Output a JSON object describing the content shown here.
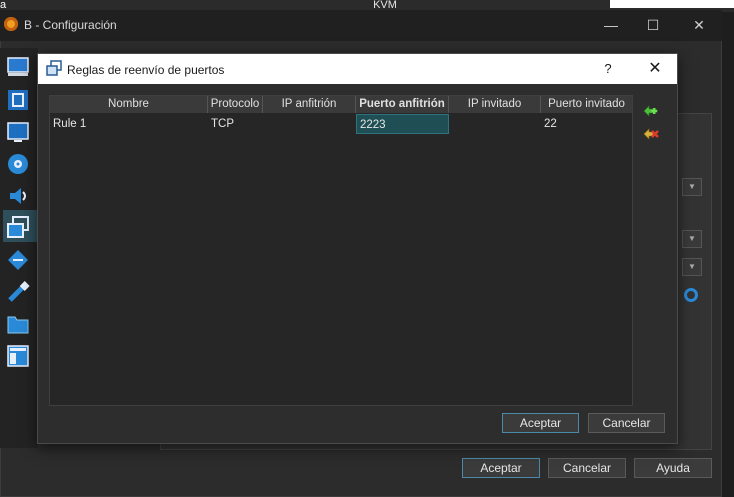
{
  "background": {
    "top_left_text": "a",
    "top_tab_text": "KVM"
  },
  "window": {
    "title": "B - Configuración",
    "minimize_glyph": "—",
    "maximize_glyph": "☐",
    "close_glyph": "✕"
  },
  "sidebar": {
    "items": [
      {
        "name": "general-icon"
      },
      {
        "name": "system-icon"
      },
      {
        "name": "display-icon"
      },
      {
        "name": "storage-icon"
      },
      {
        "name": "audio-icon"
      },
      {
        "name": "network-icon",
        "active": true
      },
      {
        "name": "serial-ports-icon"
      },
      {
        "name": "usb-icon"
      },
      {
        "name": "shared-folders-icon"
      },
      {
        "name": "user-interface-icon"
      }
    ]
  },
  "dialog": {
    "title": "Reglas de reenvío de puertos",
    "help_glyph": "?",
    "close_glyph": "✕",
    "columns": [
      "Nombre",
      "Protocolo",
      "IP anfitrión",
      "Puerto anfitrión",
      "IP invitado",
      "Puerto invitado"
    ],
    "rows": [
      {
        "name": "Rule 1",
        "protocol": "TCP",
        "host_ip": "",
        "host_port": "2223",
        "guest_ip": "",
        "guest_port": "22"
      }
    ],
    "accept_label": "Aceptar",
    "cancel_label": "Cancelar"
  },
  "main_buttons": {
    "accept_label": "Aceptar",
    "cancel_label": "Cancelar",
    "help_label": "Ayuda"
  },
  "colors": {
    "accent": "#2f7380",
    "selected_cell": "#1f4f55"
  }
}
